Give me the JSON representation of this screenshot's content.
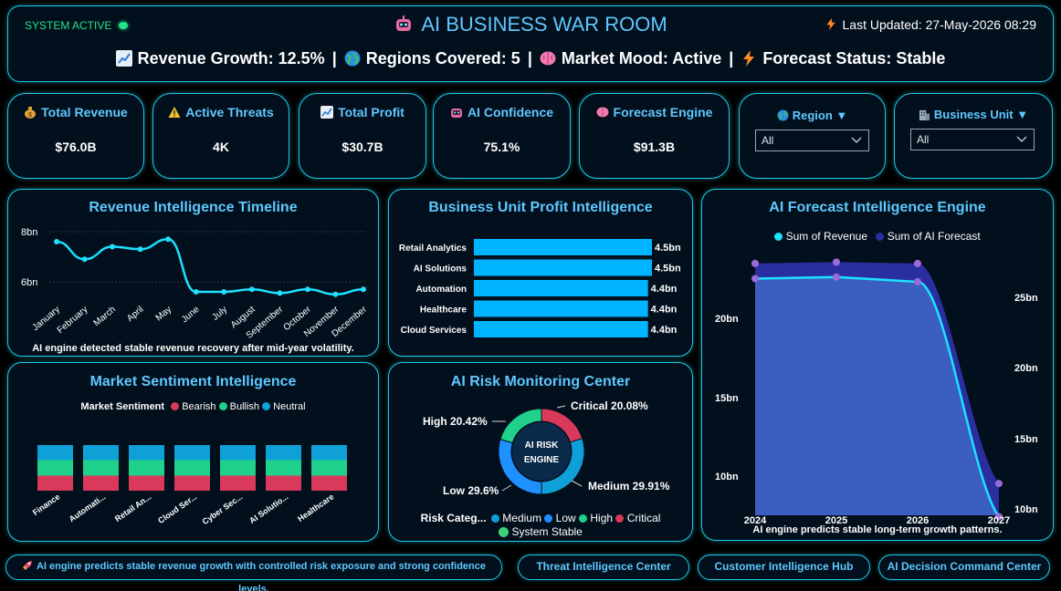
{
  "header": {
    "status": "SYSTEM ACTIVE",
    "title": "AI BUSINESS WAR ROOM",
    "last_updated": "Last Updated: 27-May-2026 08:29",
    "metrics": [
      {
        "icon": "chart-up-icon",
        "text": "Revenue Growth: 12.5%"
      },
      {
        "icon": "globe-icon",
        "text": "Regions Covered: 5"
      },
      {
        "icon": "brain-icon",
        "text": "Market Mood: Active"
      },
      {
        "icon": "lightning-icon",
        "text": "Forecast Status: Stable"
      }
    ],
    "separator": "|"
  },
  "kpis": [
    {
      "label": "Total Revenue",
      "value": "$76.0B",
      "icon": "money-bag-icon"
    },
    {
      "label": "Active Threats",
      "value": "4K",
      "icon": "warning-icon"
    },
    {
      "label": "Total Profit",
      "value": "$30.7B",
      "icon": "chart-up-icon"
    },
    {
      "label": "AI Confidence",
      "value": "75.1%",
      "icon": "robot-icon"
    },
    {
      "label": "Forecast Engine",
      "value": "$91.3B",
      "icon": "brain-icon"
    }
  ],
  "filters": [
    {
      "label": "Region ▼",
      "value": "All",
      "icon": "globe-icon"
    },
    {
      "label": "Business Unit ▼",
      "value": "All",
      "icon": "building-icon"
    }
  ],
  "revenue_timeline": {
    "title": "Revenue Intelligence Timeline",
    "note": "AI engine detected stable revenue recovery after mid-year volatility.",
    "y_ticks": [
      "8bn",
      "6bn"
    ]
  },
  "bu_profit": {
    "title": "Business Unit Profit Intelligence"
  },
  "forecast": {
    "title": "AI Forecast Intelligence Engine",
    "note": "AI engine predicts stable long-term growth patterns.",
    "legend": [
      "Sum of Revenue",
      "Sum of AI Forecast"
    ],
    "left_ticks": [
      "20bn",
      "15bn",
      "10bn"
    ],
    "right_ticks": [
      "25bn",
      "20bn",
      "15bn",
      "10bn"
    ]
  },
  "sentiment": {
    "title": "Market Sentiment Intelligence",
    "legend_title": "Market Sentiment",
    "legend": [
      "Bearish",
      "Bullish",
      "Neutral"
    ]
  },
  "risk": {
    "title": "AI Risk Monitoring Center",
    "center_line1": "AI RISK",
    "center_line2": "ENGINE",
    "legend_title": "Risk Categ...",
    "legend": [
      "Medium",
      "Low",
      "High",
      "Critical"
    ],
    "legend_extra": "System Stable",
    "labels": {
      "critical": "Critical 20.08%",
      "high": "High 20.42%",
      "low": "Low 29.6%",
      "medium": "Medium 29.91%"
    }
  },
  "footer": {
    "message": "AI engine predicts stable revenue growth with controlled risk exposure and strong confidence levels.",
    "buttons": [
      "Threat Intelligence Center",
      "Customer Intelligence Hub",
      "AI Decision Command Center"
    ]
  },
  "colors": {
    "accent": "#1ec8e6",
    "title": "#5fc8ff",
    "bar": "#00b4ff",
    "bearish": "#d9395a",
    "bullish": "#1fd18a",
    "neutral": "#0fa0d8",
    "forecast_area": "#3a5fc0",
    "forecast_top": "#2a2fa0"
  },
  "chart_data": [
    {
      "type": "line",
      "title": "Revenue Intelligence Timeline",
      "categories": [
        "January",
        "February",
        "March",
        "April",
        "May",
        "June",
        "July",
        "August",
        "September",
        "October",
        "November",
        "December"
      ],
      "values": [
        7.6,
        6.9,
        7.4,
        7.3,
        7.7,
        5.6,
        5.6,
        5.7,
        5.55,
        5.7,
        5.5,
        5.7
      ],
      "ylim": [
        5,
        8.5
      ],
      "unit": "bn"
    },
    {
      "type": "bar",
      "title": "Business Unit Profit Intelligence",
      "orientation": "horizontal",
      "categories": [
        "Retail Analytics",
        "AI Solutions",
        "Automation",
        "Healthcare",
        "Cloud Services"
      ],
      "values": [
        4.5,
        4.5,
        4.4,
        4.4,
        4.4
      ],
      "labels": [
        "4.5bn",
        "4.5bn",
        "4.4bn",
        "4.4bn",
        "4.4bn"
      ]
    },
    {
      "type": "area",
      "title": "AI Forecast Intelligence Engine",
      "x": [
        2024,
        2025,
        2026,
        2027
      ],
      "series": [
        {
          "name": "Sum of Revenue",
          "values": [
            22.5,
            22.6,
            22.3,
            7.5
          ]
        },
        {
          "name": "Sum of AI Forecast",
          "values": [
            27.4,
            27.5,
            27.4,
            11.8
          ]
        }
      ],
      "left_ylim": [
        8,
        24
      ],
      "right_ylim": [
        10,
        28
      ]
    },
    {
      "type": "bar",
      "title": "Market Sentiment Intelligence",
      "stacked": true,
      "categories": [
        "Finance",
        "Automati...",
        "Retail An...",
        "Cloud Ser...",
        "Cyber Sec...",
        "AI Solutio...",
        "Healthcare"
      ],
      "series": [
        {
          "name": "Bearish",
          "values": [
            33,
            33,
            33,
            33,
            33,
            33,
            33
          ]
        },
        {
          "name": "Bullish",
          "values": [
            34,
            34,
            34,
            34,
            34,
            34,
            34
          ]
        },
        {
          "name": "Neutral",
          "values": [
            33,
            33,
            33,
            33,
            33,
            33,
            33
          ]
        }
      ]
    },
    {
      "type": "pie",
      "title": "AI Risk Monitoring Center",
      "categories": [
        "Critical",
        "Medium",
        "Low",
        "High"
      ],
      "values": [
        20.08,
        29.91,
        29.6,
        20.42
      ]
    }
  ]
}
